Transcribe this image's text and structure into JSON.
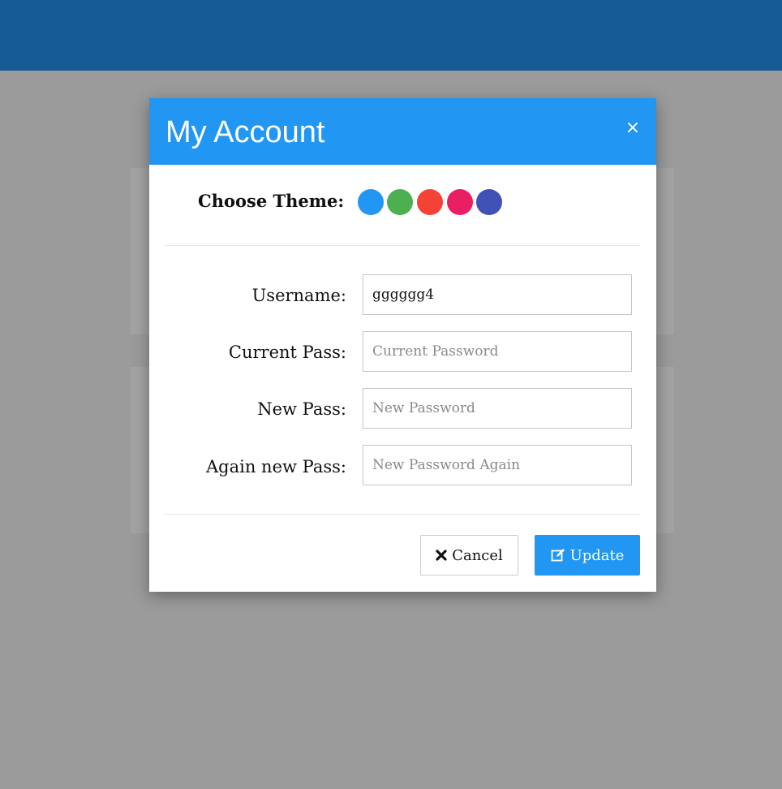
{
  "colors": {
    "topbar": "#165b96",
    "overlay": "#9b9b9b",
    "accent": "#2196f3"
  },
  "modal": {
    "title": "My Account",
    "close_label": "×",
    "close_icon": "close-icon",
    "theme": {
      "label": "Choose Theme:",
      "swatches": [
        {
          "name": "blue",
          "color": "#2196f3"
        },
        {
          "name": "green",
          "color": "#4caf50"
        },
        {
          "name": "red",
          "color": "#f44336"
        },
        {
          "name": "pink",
          "color": "#e91e63"
        },
        {
          "name": "indigo",
          "color": "#3f51b5"
        }
      ]
    },
    "form": {
      "username": {
        "label": "Username:",
        "value": "gggggg4",
        "placeholder": ""
      },
      "current_pass": {
        "label": "Current Pass:",
        "value": "",
        "placeholder": "Current Password"
      },
      "new_pass": {
        "label": "New Pass:",
        "value": "",
        "placeholder": "New Password"
      },
      "again_new_pass": {
        "label": "Again new Pass:",
        "value": "",
        "placeholder": "New Password Again"
      }
    },
    "buttons": {
      "cancel_label": "Cancel",
      "cancel_icon": "close-icon",
      "update_label": "Update",
      "update_icon": "edit-icon"
    }
  }
}
